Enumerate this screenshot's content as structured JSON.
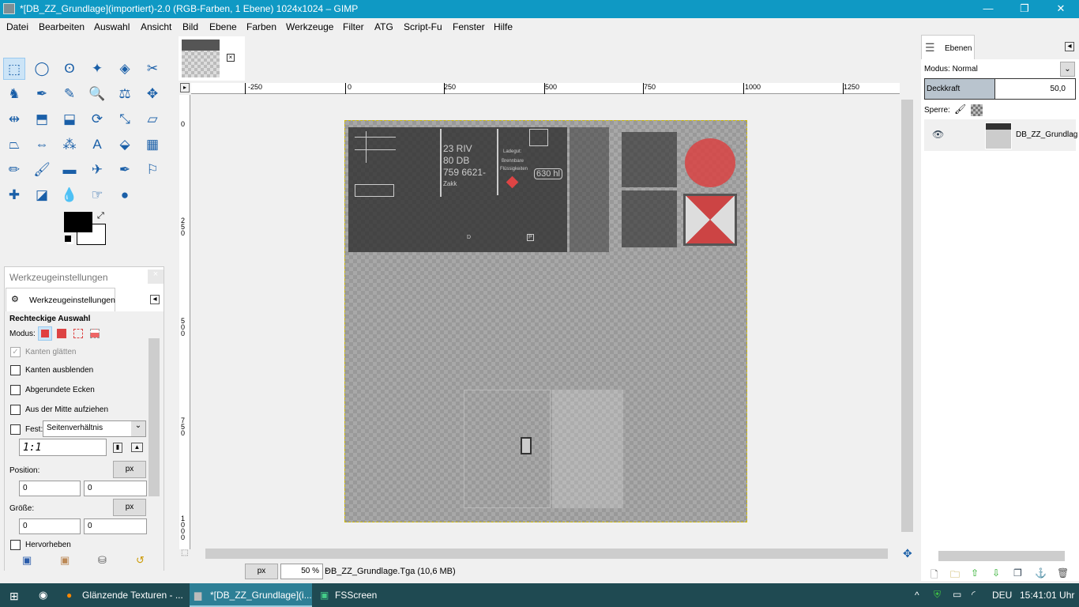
{
  "window": {
    "title": "*[DB_ZZ_Grundlage](importiert)-2.0 (RGB-Farben, 1 Ebene) 1024x1024 – GIMP",
    "minimize": "—",
    "maximize": "❐",
    "close": "✕"
  },
  "menu": [
    "Datei",
    "Bearbeiten",
    "Auswahl",
    "Ansicht",
    "Bild",
    "Ebene",
    "Farben",
    "Werkzeuge",
    "Filter",
    "ATG",
    "Script-Fu",
    "Fenster",
    "Hilfe"
  ],
  "tools": [
    "rect-select",
    "ellipse-select",
    "free-select",
    "fuzzy-select",
    "color-select",
    "scissors",
    "foreground-select",
    "paths",
    "color-picker",
    "zoom",
    "measure",
    "move",
    "align",
    "transform",
    "crop",
    "rotate",
    "scale",
    "shear",
    "perspective",
    "flip",
    "cage",
    "text",
    "bucket-fill",
    "blend",
    "pencil",
    "paintbrush",
    "eraser",
    "airbrush",
    "ink",
    "clone",
    "heal",
    "perspective-clone",
    "blur",
    "smudge",
    "dodge-burn"
  ],
  "tool_glyphs": [
    "⬚",
    "◯",
    "ʘ",
    "✦",
    "◈",
    "✂",
    "♞",
    "✒",
    "✎",
    "🔍",
    "⚖",
    "✥",
    "⇹",
    "⬒",
    "⬓",
    "⟳",
    "⤡",
    "▱",
    "⏢",
    "⇔",
    "⁂",
    "A",
    "⬙",
    "▦",
    "✏",
    "🖌",
    "▬",
    "✈",
    "✒",
    "⚐",
    "✚",
    "◪",
    "💧",
    "☞",
    "●"
  ],
  "colors": {
    "foreground": "#000000",
    "background": "#ffffff",
    "accent": "#0f99c4"
  },
  "tool_options": {
    "dialog_title": "Werkzeugeinstellungen",
    "tab": "Werkzeugeinstellungen",
    "heading": "Rechteckige Auswahl",
    "mode_label": "Modus:",
    "antialias": "Kanten glätten",
    "feather": "Kanten ausblenden",
    "rounded": "Abgerundete Ecken",
    "from_center": "Aus der Mitte aufziehen",
    "fixed": "Fest:",
    "fixed_select": "Seitenverhältnis",
    "ratio": "1:1",
    "position_label": "Position:",
    "position_unit": "px",
    "pos_x": "0",
    "pos_y": "0",
    "size_label": "Größe:",
    "size_unit": "px",
    "size_x": "0",
    "size_y": "0",
    "highlight": "Hervorheben"
  },
  "rulers": {
    "h": [
      "-250",
      "0",
      "250",
      "500",
      "750",
      "1000",
      "1250"
    ],
    "v": [
      "0",
      "250",
      "500",
      "750",
      "1000"
    ]
  },
  "texture": {
    "t1": "23 RIV",
    "t2": "80 DB",
    "t3": "759 6621-",
    "t4": "Zakk",
    "t5": "Ladegut:",
    "t6": "Brennbare",
    "t7": "Flüssigkeiten",
    "t8": "630 hl",
    "t9": "D",
    "t10": "P"
  },
  "status": {
    "unit": "px",
    "zoom": "50 %",
    "file": "DB_ZZ_Grundlage.Tga (10,6 MB)"
  },
  "layers": {
    "tab": "Ebenen",
    "mode": "Modus: Normal",
    "opacity_label": "Deckkraft",
    "opacity": "50,0",
    "lock_label": "Sperre:",
    "layer_name": "DB_ZZ_Grundlag"
  },
  "taskbar": {
    "items": [
      "Glänzende Texturen - ...",
      "*[DB_ZZ_Grundlage](i...",
      "FSScreen"
    ],
    "lang": "DEU",
    "time": "15:41:01 Uhr"
  }
}
